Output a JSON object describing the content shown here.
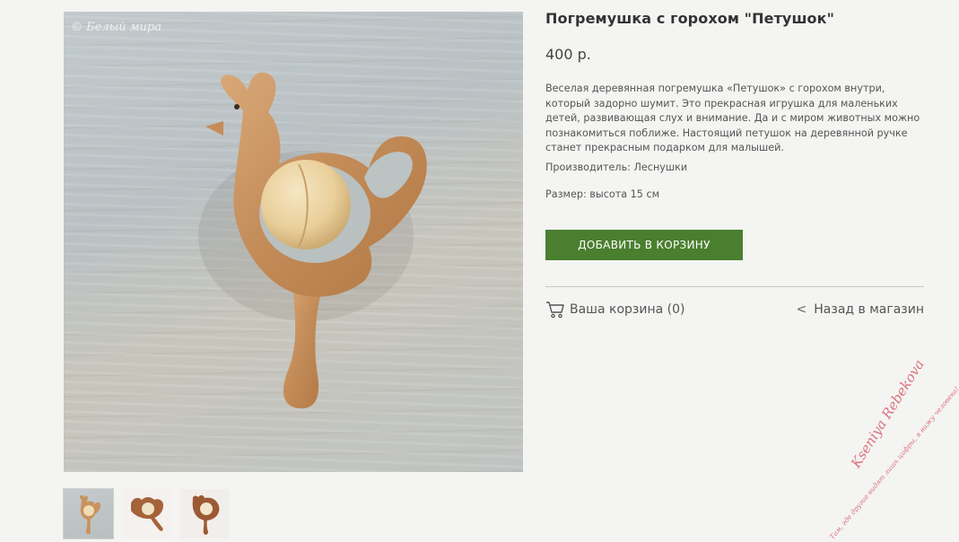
{
  "product": {
    "title": "Погремушка с горохом \"Петушок\"",
    "price": "400 р.",
    "description": "Веселая деревянная погремушка «Петушок» с горохом внутри, который задорно шумит. Это прекрасная игрушка для маленьких детей, развивающая слух и внимание. Да и с миром животных можно познакомиться поближе. Настоящий петушок на деревянной ручке станет прекрасным подарком для малышей.",
    "maker": "Производитель: Леснушки",
    "size": "Размер: высота 15 см"
  },
  "photo": {
    "watermark": "© Белый мира"
  },
  "actions": {
    "add_to_cart": "ДОБАВИТЬ В КОРЗИНУ",
    "cart_link": "Ваша корзина (0)",
    "back_link": "Назад в магазин"
  },
  "signature": {
    "name": "Kseniya Rebekova",
    "motto": "Там, где другие видят лишь цифры, я вижу человека!"
  },
  "colors": {
    "button_green": "#4a7f2f",
    "wood": "#c8935e",
    "signature_pink": "#d65a69"
  },
  "icons": [
    "cart-icon",
    "chevron-left-icon"
  ]
}
